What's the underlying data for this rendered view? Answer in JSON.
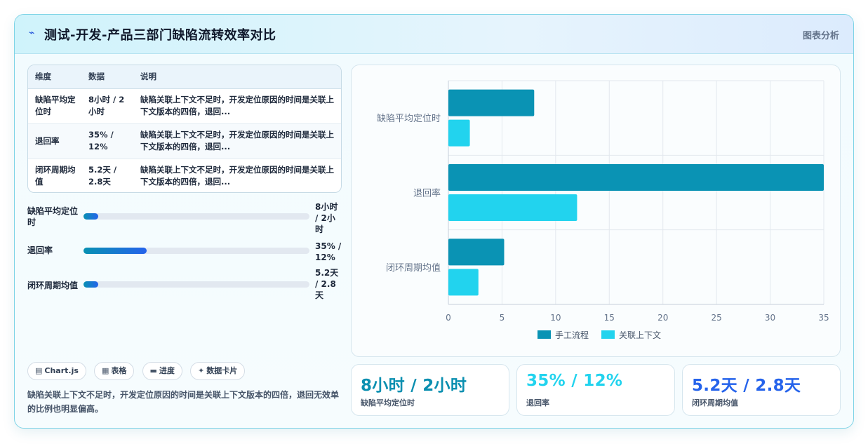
{
  "header": {
    "icon": "chart-line-icon",
    "title": "测试-开发-产品三部门缺陷流转效率对比",
    "tag": "图表分析"
  },
  "table": {
    "headers": [
      "维度",
      "数据",
      "说明"
    ],
    "rows": [
      {
        "dim": "缺陷平均定位时",
        "data": "8小时 / 2小时",
        "note": "缺陷关联上下文不足时，开发定位原因的时间是关联上下文版本的四倍，退回..."
      },
      {
        "dim": "退回率",
        "data": "35% / 12%",
        "note": "缺陷关联上下文不足时，开发定位原因的时间是关联上下文版本的四倍，退回..."
      },
      {
        "dim": "闭环周期均值",
        "data": "5.2天 / 2.8天",
        "note": "缺陷关联上下文不足时，开发定位原因的时间是关联上下文版本的四倍，退回..."
      }
    ]
  },
  "progress": [
    {
      "label": "缺陷平均定位时",
      "value": "8小时 / 2小时",
      "fraction": 0.065
    },
    {
      "label": "退回率",
      "value": "35% / 12%",
      "fraction": 0.28
    },
    {
      "label": "闭环周期均值",
      "value": "5.2天 / 2.8天",
      "fraction": 0.065
    }
  ],
  "chips": [
    {
      "icon": "chart-icon",
      "glyph": "▤",
      "label": "Chart.js"
    },
    {
      "icon": "table-icon",
      "glyph": "▦",
      "label": "表格"
    },
    {
      "icon": "progress-icon",
      "glyph": "▬",
      "label": "进度"
    },
    {
      "icon": "sparkle-icon",
      "glyph": "✦",
      "label": "数据卡片"
    }
  ],
  "summary": "缺陷关联上下文不足时，开发定位原因的时间是关联上下文版本的四倍，退回无效单的比例也明显偏高。",
  "chart_data": {
    "type": "bar",
    "orientation": "horizontal",
    "categories": [
      "缺陷平均定位时",
      "退回率",
      "闭环周期均值"
    ],
    "series": [
      {
        "name": "手工流程",
        "values": [
          8,
          35,
          5.2
        ],
        "color": "#0a93b4"
      },
      {
        "name": "关联上下文",
        "values": [
          2,
          12,
          2.8
        ],
        "color": "#22d3ee"
      }
    ],
    "xlim": [
      0,
      35
    ],
    "xticks": [
      0,
      5,
      10,
      15,
      20,
      25,
      30,
      35
    ],
    "grid": true,
    "legend": "bottom"
  },
  "stats": [
    {
      "value": "8小时 / 2小时",
      "label": "缺陷平均定位时",
      "color": "#0a8fb0"
    },
    {
      "value": "35% / 12%",
      "label": "退回率",
      "color": "#22d3ee"
    },
    {
      "value": "5.2天 / 2.8天",
      "label": "闭环周期均值",
      "color": "#2563eb"
    }
  ]
}
